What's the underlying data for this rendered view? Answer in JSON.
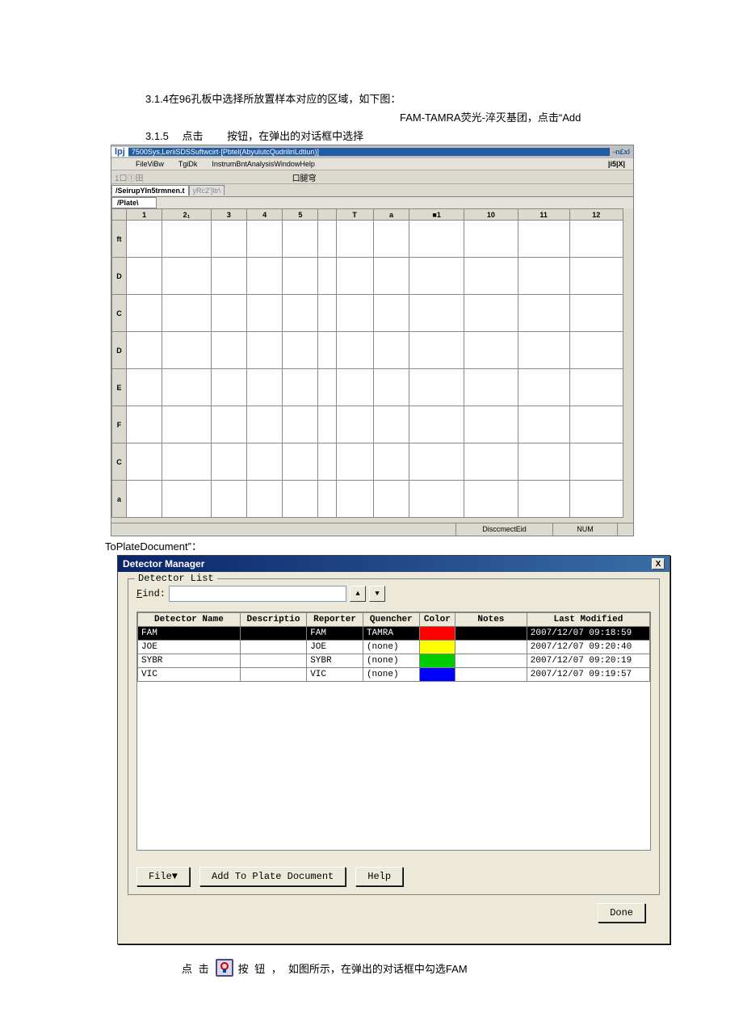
{
  "doc": {
    "step314": "3.1.4在96孔板中选择所放置样本对应的区域，如下图：",
    "step314b": "FAM-TAMRA荧光-淬灭基团，点击“Add",
    "step315": "3.1.5  点击   按钮，在弹出的对话框中选择",
    "toPlate": "ToPlateDocument”：",
    "bottom1": "点 击",
    "bottom2": "按 钮 ，",
    "bottom3": "如图所示，在弹出的对话框中勾选FAM"
  },
  "app": {
    "lpj": "lpj",
    "title": "7500Sys,LeriiSDSSuftwcirt·[Pbtel(AbyulutcQudriliriLdtiun)]",
    "nex": "-n£xl",
    "menu": {
      "file": "FileViBw",
      "tgidk": "TgiDk",
      "instrum": "InstrumBntAnalysisWindowHelp"
    },
    "i5x": "|i5|X|",
    "tbleft": "1口①田",
    "tbmid": "口腿穹",
    "tab1": "/SeirupYIn5trmnen.t",
    "tab2": "yRc2']ltr\\",
    "plateLabel": "/Plate\\",
    "cols": [
      "",
      "1",
      "2₁",
      "3",
      "4",
      "5",
      "",
      "T",
      "a",
      "■1",
      "10",
      "11",
      "12"
    ],
    "rows": [
      "ft",
      "D",
      "C",
      "D",
      "E",
      "F",
      "C",
      "a"
    ],
    "status": {
      "disc": "DisccmectEid",
      "num": "NUM"
    }
  },
  "dialog": {
    "title": "Detector Manager",
    "legend": "Detector List",
    "findLabel": "Find:",
    "headers": [
      "Detector Name",
      "Descriptio",
      "Reporter",
      "Quencher",
      "Color",
      "Notes",
      "Last Modified"
    ],
    "rows": [
      {
        "name": "FAM",
        "desc": "",
        "reporter": "FAM",
        "quencher": "TAMRA",
        "color": "#ff0000",
        "notes": "",
        "modified": "2007/12/07 09:18:59",
        "selected": true
      },
      {
        "name": "JOE",
        "desc": "",
        "reporter": "JOE",
        "quencher": "(none)",
        "color": "#ffff00",
        "notes": "",
        "modified": "2007/12/07 09:20:40",
        "selected": false
      },
      {
        "name": "SYBR",
        "desc": "",
        "reporter": "SYBR",
        "quencher": "(none)",
        "color": "#00cc00",
        "notes": "",
        "modified": "2007/12/07 09:20:19",
        "selected": false
      },
      {
        "name": "VIC",
        "desc": "",
        "reporter": "VIC",
        "quencher": "(none)",
        "color": "#0000ff",
        "notes": "",
        "modified": "2007/12/07 09:19:57",
        "selected": false
      }
    ],
    "buttons": {
      "file": "File▼",
      "add": "Add To Plate Document",
      "help": "Help",
      "done": "Done"
    }
  }
}
